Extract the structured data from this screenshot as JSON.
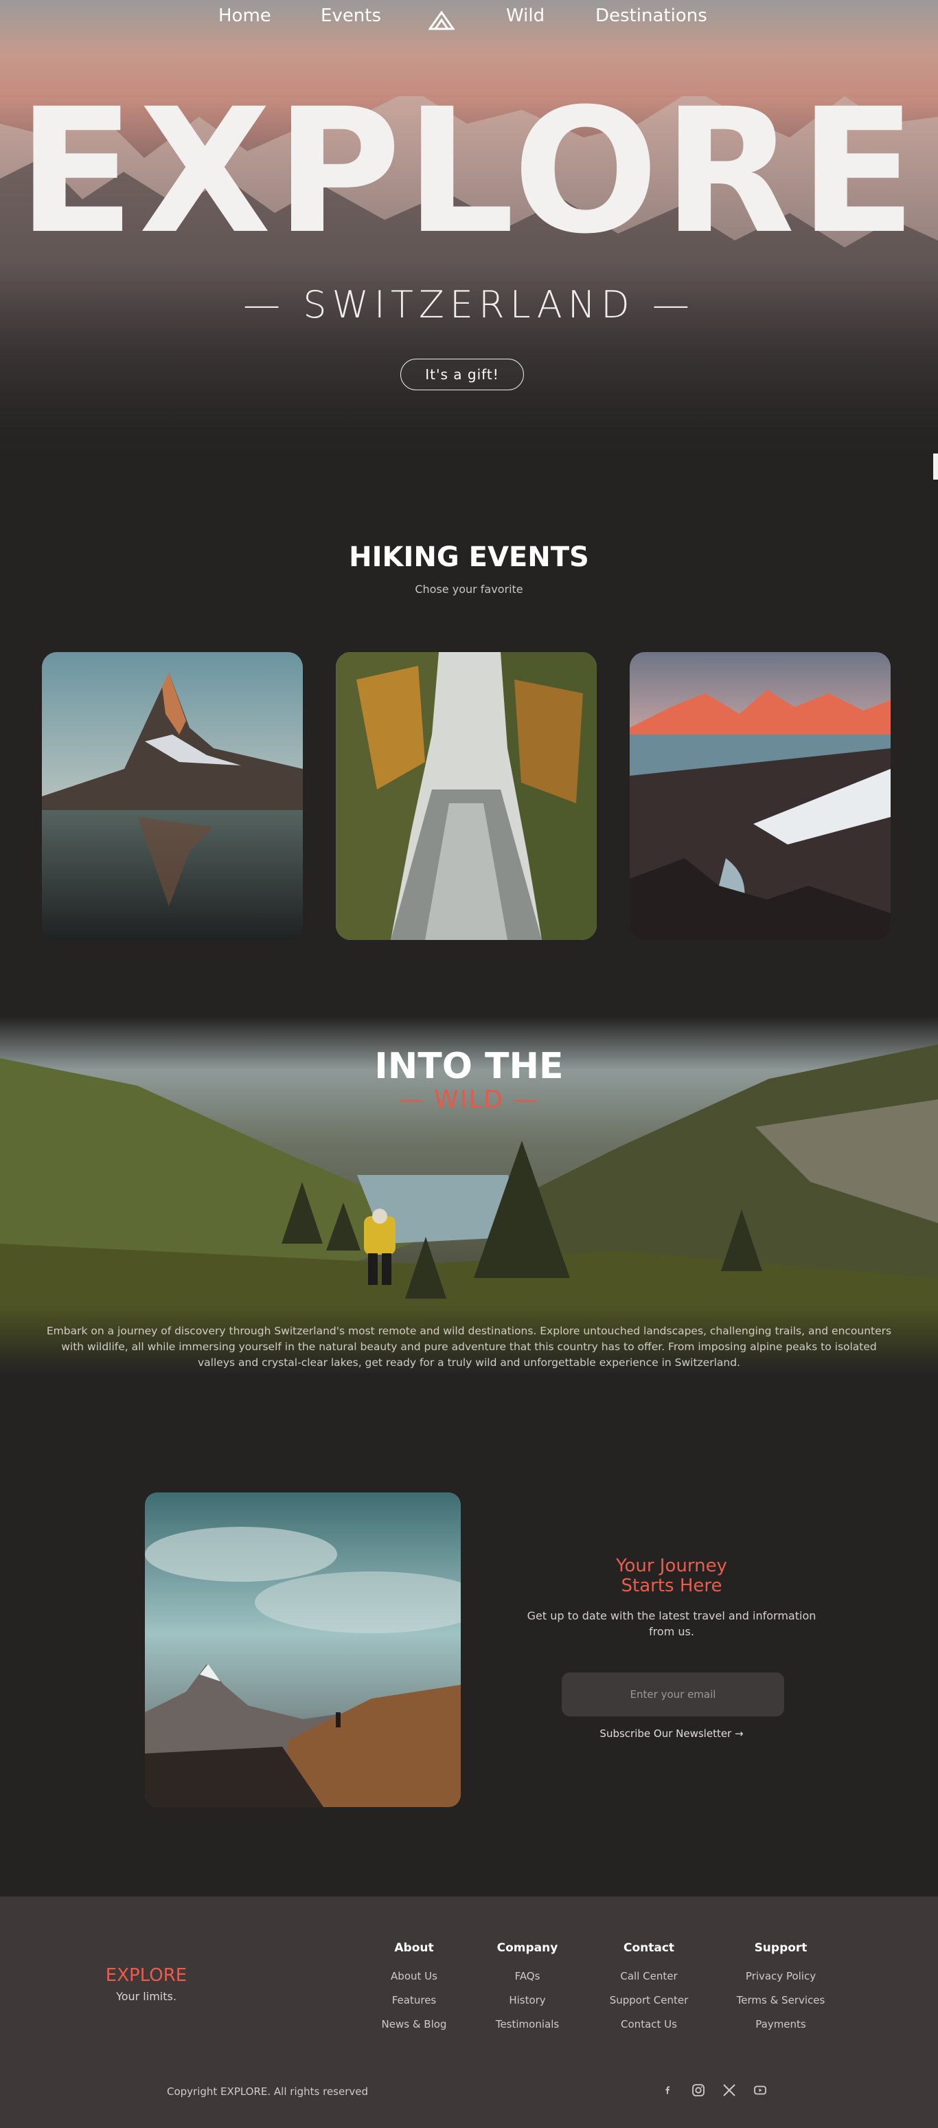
{
  "nav": {
    "items": [
      "Home",
      "Events",
      "Wild",
      "Destinations"
    ]
  },
  "hero": {
    "title": "EXPLORE",
    "subtitle": "— SWITZERLAND —",
    "button": "It's a gift!"
  },
  "hiking": {
    "title": "HIKING EVENTS",
    "subtitle": "Chose your favorite"
  },
  "wild": {
    "title": "INTO THE",
    "subtitle": "— WILD —",
    "text": "Embark on a journey of discovery through Switzerland's most remote and wild destinations. Explore untouched landscapes, challenging trails, and encounters with wildlife, all while immersing yourself in the natural beauty and pure adventure that this country has to offer. From imposing alpine peaks to isolated valleys and crystal-clear lakes, get ready for a truly wild and unforgettable experience in Switzerland."
  },
  "journey": {
    "title_line1": "Your Journey",
    "title_line2": "Starts Here",
    "subtitle": "Get up to date with the latest travel and information from us.",
    "email_placeholder": "Enter your email",
    "newsletter": "Subscribe Our Newsletter →"
  },
  "footer": {
    "brand": "EXPLORE",
    "tagline": "Your limits.",
    "columns": [
      {
        "title": "About",
        "links": [
          "About Us",
          "Features",
          "News & Blog"
        ]
      },
      {
        "title": "Company",
        "links": [
          "FAQs",
          "History",
          "Testimonials"
        ]
      },
      {
        "title": "Contact",
        "links": [
          "Call Center",
          "Support Center",
          "Contact Us"
        ]
      },
      {
        "title": "Support",
        "links": [
          "Privacy Policy",
          "Terms & Services",
          "Payments"
        ]
      }
    ],
    "copyright": "Copyright EXPLORE. All rights reserved",
    "socials": [
      "facebook-icon",
      "instagram-icon",
      "x-icon",
      "youtube-icon"
    ]
  },
  "colors": {
    "accent": "#ea5d4c",
    "background": "#242322",
    "footer": "#3e3838"
  }
}
